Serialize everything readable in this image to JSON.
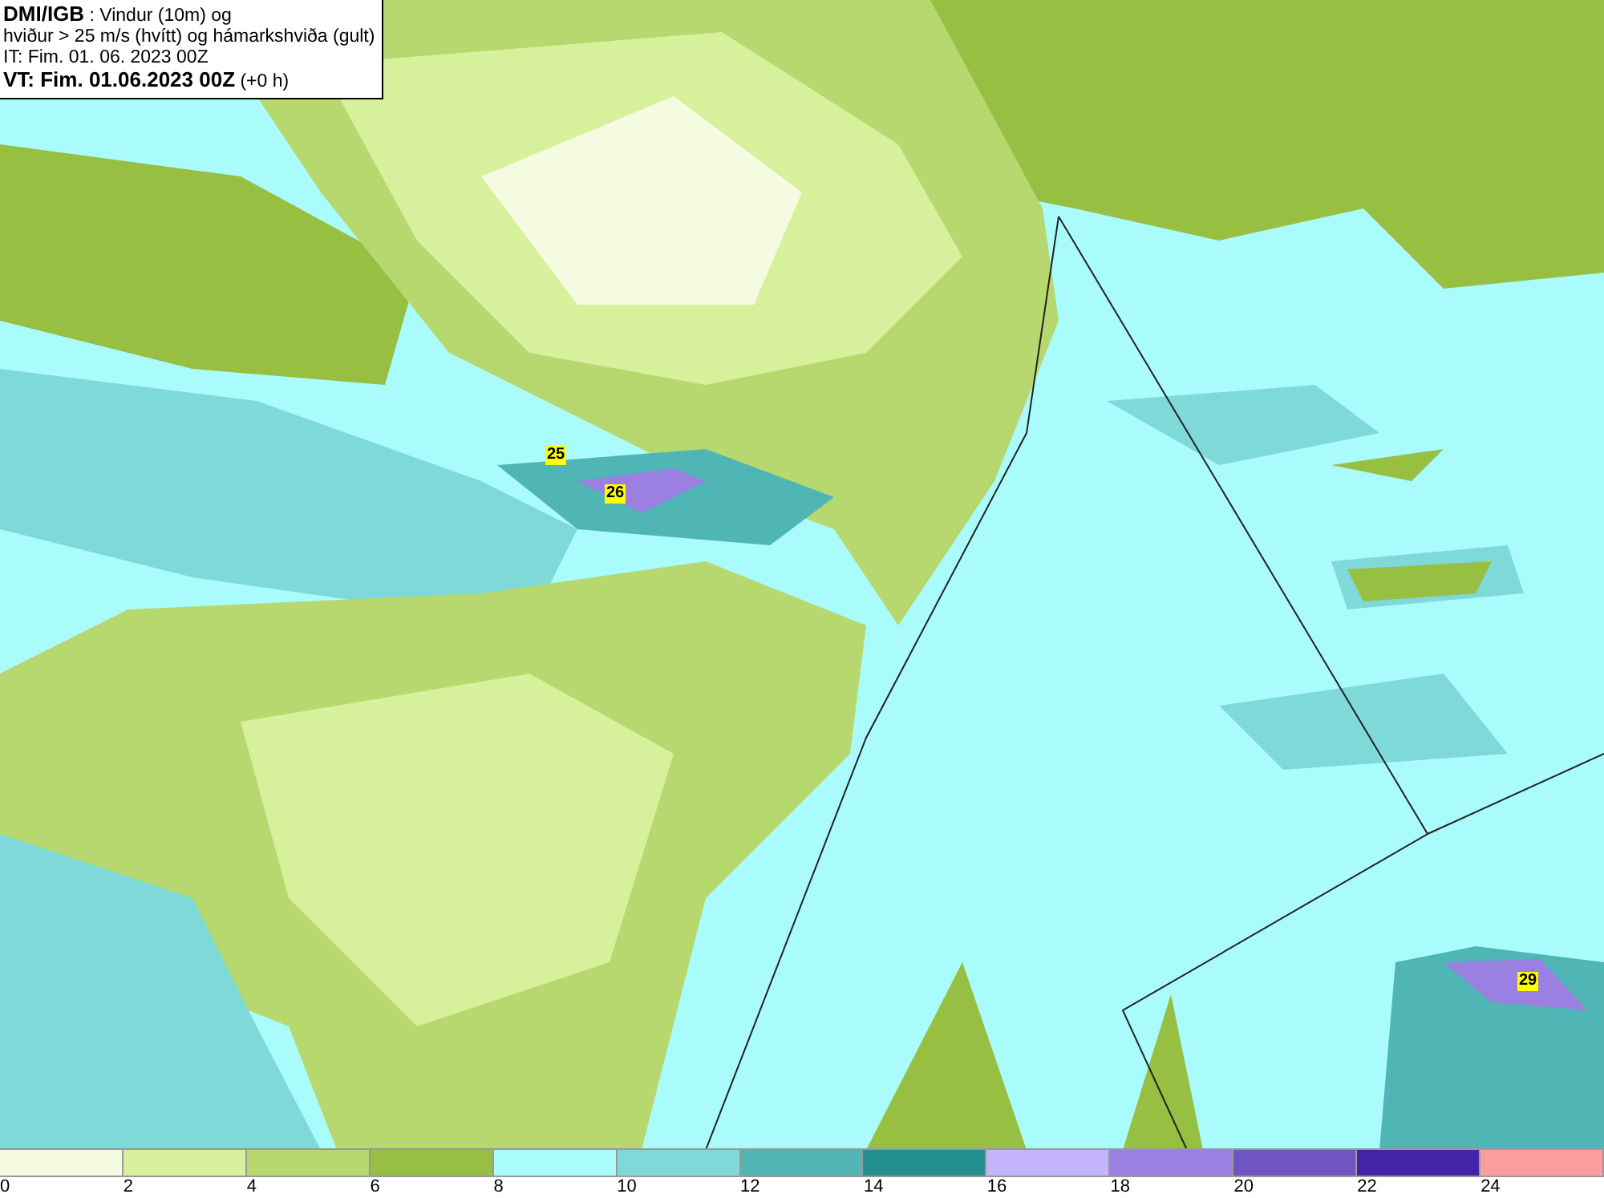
{
  "title_box": {
    "source": "DMI/IGB",
    "line_1": " : Vindur (10m) og",
    "line_2": "hviður > 25 m/s (hvítt) og hámarkshviða (gult)",
    "issue_time": "IT: Fim. 01. 06. 2023 00Z",
    "valid_time": "VT: Fim. 01.06.2023 00Z",
    "lead": " (+0 h)"
  },
  "gust_labels": [
    "25",
    "26",
    "29"
  ],
  "legend": [
    {
      "label": "0",
      "color": "#f5fbe0"
    },
    {
      "label": "2",
      "color": "#d7f09b"
    },
    {
      "label": "4",
      "color": "#b6d86f"
    },
    {
      "label": "6",
      "color": "#97bf42"
    },
    {
      "label": "8",
      "color": "#aafcfc"
    },
    {
      "label": "10",
      "color": "#7fd9d9"
    },
    {
      "label": "12",
      "color": "#50b5b5"
    },
    {
      "label": "14",
      "color": "#238f8f"
    },
    {
      "label": "16",
      "color": "#c3b4fc"
    },
    {
      "label": "18",
      "color": "#9a80e0"
    },
    {
      "label": "20",
      "color": "#6f54c4"
    },
    {
      "label": "22",
      "color": "#4424a6"
    },
    {
      "label": "24",
      "color": "#fc9e9e"
    }
  ]
}
